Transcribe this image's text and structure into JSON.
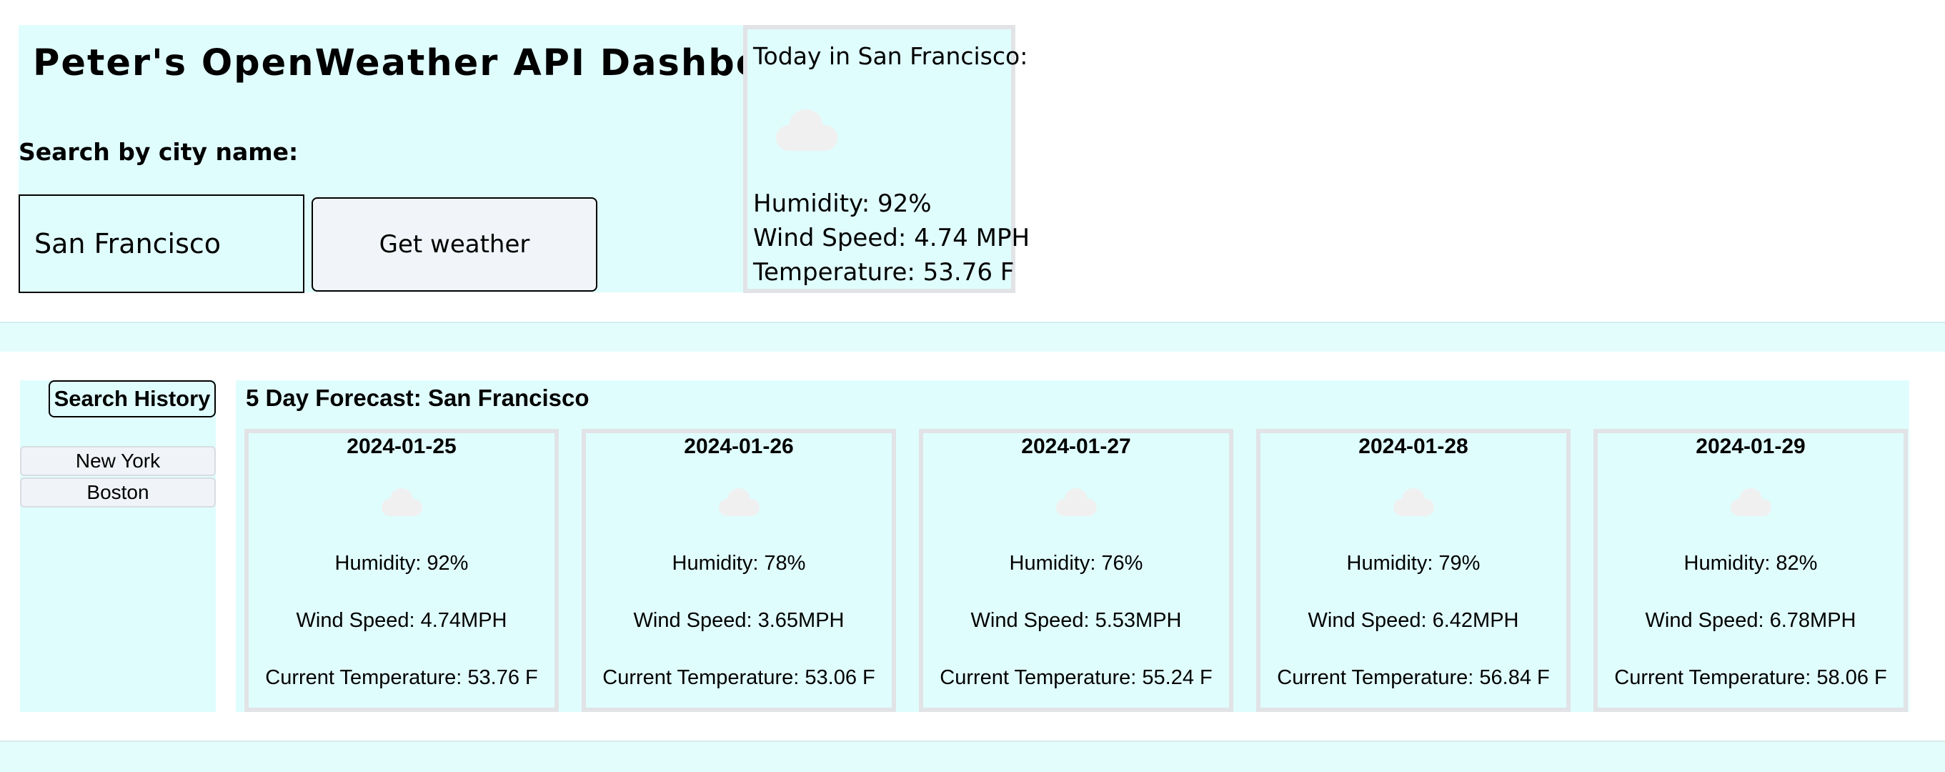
{
  "header": {
    "title": "Peter's OpenWeather API Dashboard",
    "search_label": "Search by city name:",
    "search_value": "San Francisco",
    "button_label": "Get weather"
  },
  "today": {
    "title": "Today in San Francisco:",
    "icon": "cloud-icon",
    "humidity": "Humidity: 92%",
    "wind": "Wind Speed: 4.74 MPH",
    "temperature": "Temperature: 53.76 F"
  },
  "history": {
    "button_label": "Search History",
    "items": [
      "New York",
      "Boston"
    ]
  },
  "forecast": {
    "title": "5 Day Forecast: San Francisco",
    "days": [
      {
        "date": "2024-01-25",
        "icon": "cloud-icon",
        "humidity": "Humidity: 92%",
        "wind": "Wind Speed: 4.74MPH",
        "temp": "Current Temperature: 53.76 F"
      },
      {
        "date": "2024-01-26",
        "icon": "cloud-icon",
        "humidity": "Humidity: 78%",
        "wind": "Wind Speed: 3.65MPH",
        "temp": "Current Temperature: 53.06 F"
      },
      {
        "date": "2024-01-27",
        "icon": "cloud-icon",
        "humidity": "Humidity: 76%",
        "wind": "Wind Speed: 5.53MPH",
        "temp": "Current Temperature: 55.24 F"
      },
      {
        "date": "2024-01-28",
        "icon": "cloud-icon",
        "humidity": "Humidity: 79%",
        "wind": "Wind Speed: 6.42MPH",
        "temp": "Current Temperature: 56.84 F"
      },
      {
        "date": "2024-01-29",
        "icon": "cloud-icon",
        "humidity": "Humidity: 82%",
        "wind": "Wind Speed: 6.78MPH",
        "temp": "Current Temperature: 58.06 F"
      }
    ]
  },
  "colors": {
    "panel_background": "#e0fdfd",
    "card_border": "#e1e3e6",
    "button_background": "#f1f4f8",
    "icon_color": "#f0f0f0"
  }
}
